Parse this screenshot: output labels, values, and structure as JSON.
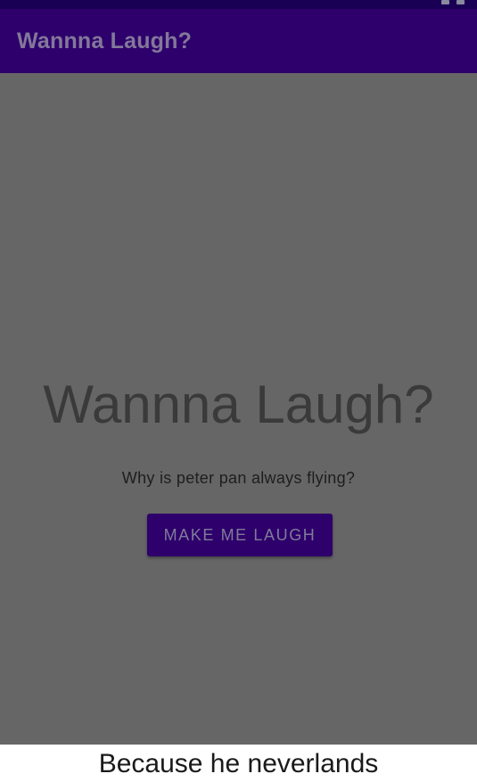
{
  "app_bar": {
    "title": "Wannna Laugh?"
  },
  "main": {
    "headline": "Wannna Laugh?",
    "question": "Why is peter pan always flying?",
    "button_label": "MAKE ME LAUGH"
  },
  "toast": {
    "message": "Because he neverlands"
  },
  "colors": {
    "primary": "#2e006c",
    "status_bar": "#1a0054",
    "dim_overlay": "#666666"
  },
  "icons": {
    "status": [
      "signal-icon",
      "battery-icon"
    ]
  }
}
